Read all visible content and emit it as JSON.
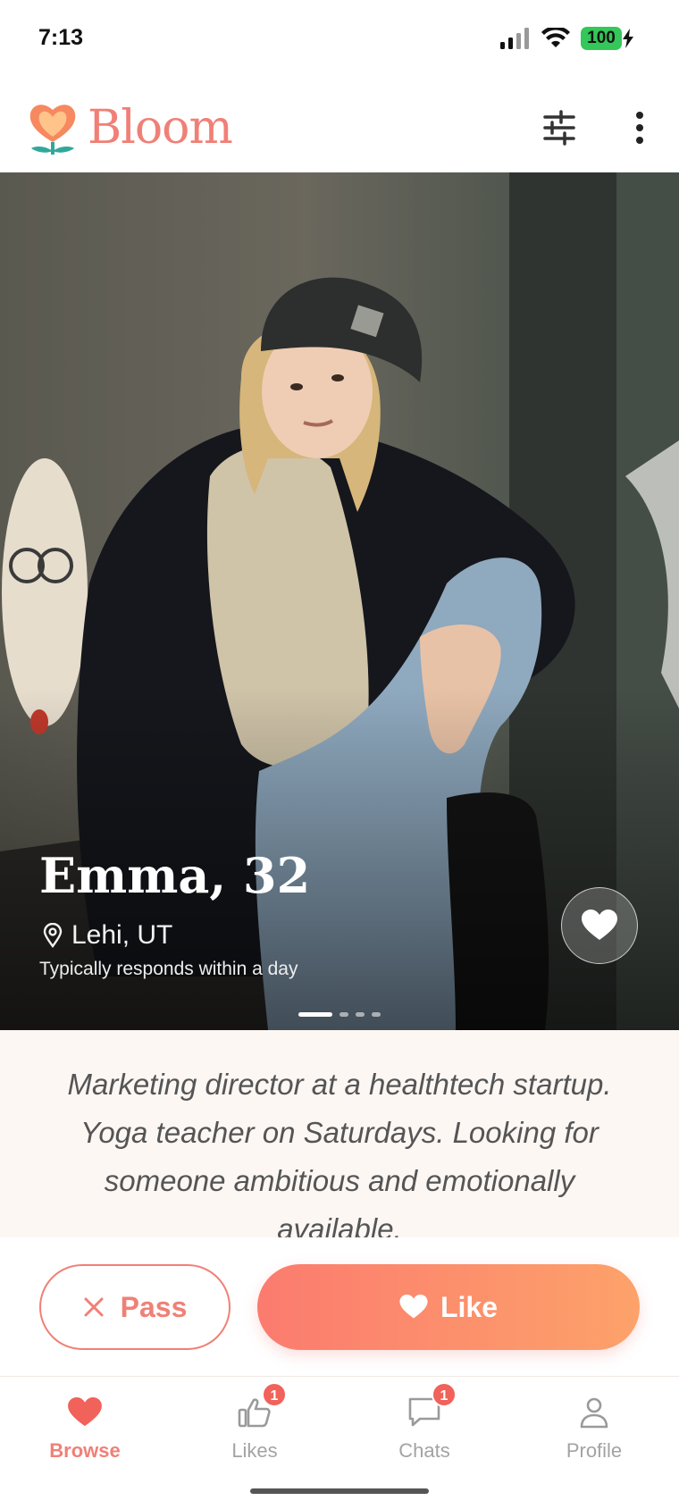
{
  "status_bar": {
    "time": "7:13",
    "battery": "100"
  },
  "header": {
    "app_name": "Bloom"
  },
  "profile": {
    "name_age": "Emma, 32",
    "location": "Lehi, UT",
    "response_time": "Typically responds within a day",
    "photo_index": 1,
    "photo_count": 4,
    "bio": "Marketing director at a healthtech startup. Yoga teacher on Saturdays. Looking for someone ambitious and emotionally available."
  },
  "actions": {
    "pass_label": "Pass",
    "like_label": "Like"
  },
  "nav": {
    "items": [
      {
        "label": "Browse",
        "active": true
      },
      {
        "label": "Likes",
        "badge": "1"
      },
      {
        "label": "Chats",
        "badge": "1"
      },
      {
        "label": "Profile"
      }
    ]
  },
  "colors": {
    "accent": "#f08077",
    "like_gradient_start": "#fb7b6f",
    "like_gradient_end": "#fda26a",
    "badge": "#f0625a"
  },
  "icons": [
    "signal-icon",
    "wifi-icon",
    "battery-icon",
    "bloom-flower-logo",
    "filter-icon",
    "more-vert-icon",
    "location-pin-icon",
    "heart-icon",
    "close-icon",
    "thumbs-up-icon",
    "chat-bubble-icon",
    "person-icon"
  ]
}
